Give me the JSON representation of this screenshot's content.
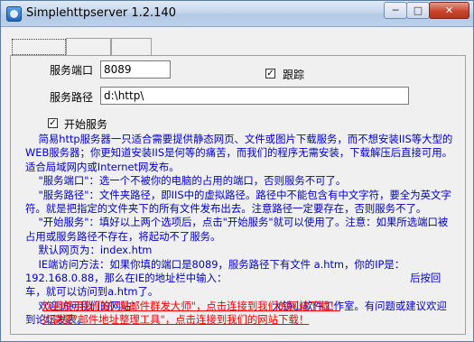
{
  "window": {
    "title": "Simplehttpserver 1.2.140",
    "minimize_glyph": "─",
    "maximize_glyph": "□",
    "close_glyph": "✕"
  },
  "tabs": [
    "",
    "",
    ""
  ],
  "form": {
    "port_label": "服务端口",
    "port_value": "8089",
    "track_label": "跟踪",
    "track_checked": "✓",
    "path_label": "服务路径",
    "path_value": "d:\\http\\",
    "start_label": "开始服务",
    "start_checked": "✓"
  },
  "info": [
    "    简易http服务器一只适合需要提供静态网页、文件或图片下载服务，而不想安装IIS等大型的WEB服务器；你更知道安装IIS是何等的痛苦，而我们的程序无需安装，下载解压后直接可用。适合局域网内或Internet网发布。",
    "    \"服务端口\"：选一个不被你的电脑的占用的端口，否则服务不可了。",
    "    \"服务路径\"：文件夹路径，即IIS中的虚拟路径。路径中不能包含有中文字符，要全为英文字符。就是把指定的文件夹下的所有文件发布出去。注意路径一定要存在，否则服务不了。",
    "    \"开始服务\"：填好以上两个选项后，点击\"开始服务\"就可以使用了。注意：如果所选端口被占用或服务路径不存在，将起动不了服务。",
    "    默认网页为：index.htm",
    "    IE端访问方法：如果你填的端口是8089，服务路径下有文件 a.htm，你的IP是：192.168.0.88，那么在IE的地址栏中输入：                                                        后按回车，就可以访问到a.htm了。",
    "    欢迎访问我们的网站：                                        大镜山软件工作室。有问题或建议欢迎到论坛发表。"
  ],
  "links": {
    "link1": "欢迎使用我们的\"易邮件群发大师\"，点击连接到我们的网站下载！",
    "link2": "如需要\"邮件地址整理工具\"，点击连接到我们的网站下载！"
  }
}
